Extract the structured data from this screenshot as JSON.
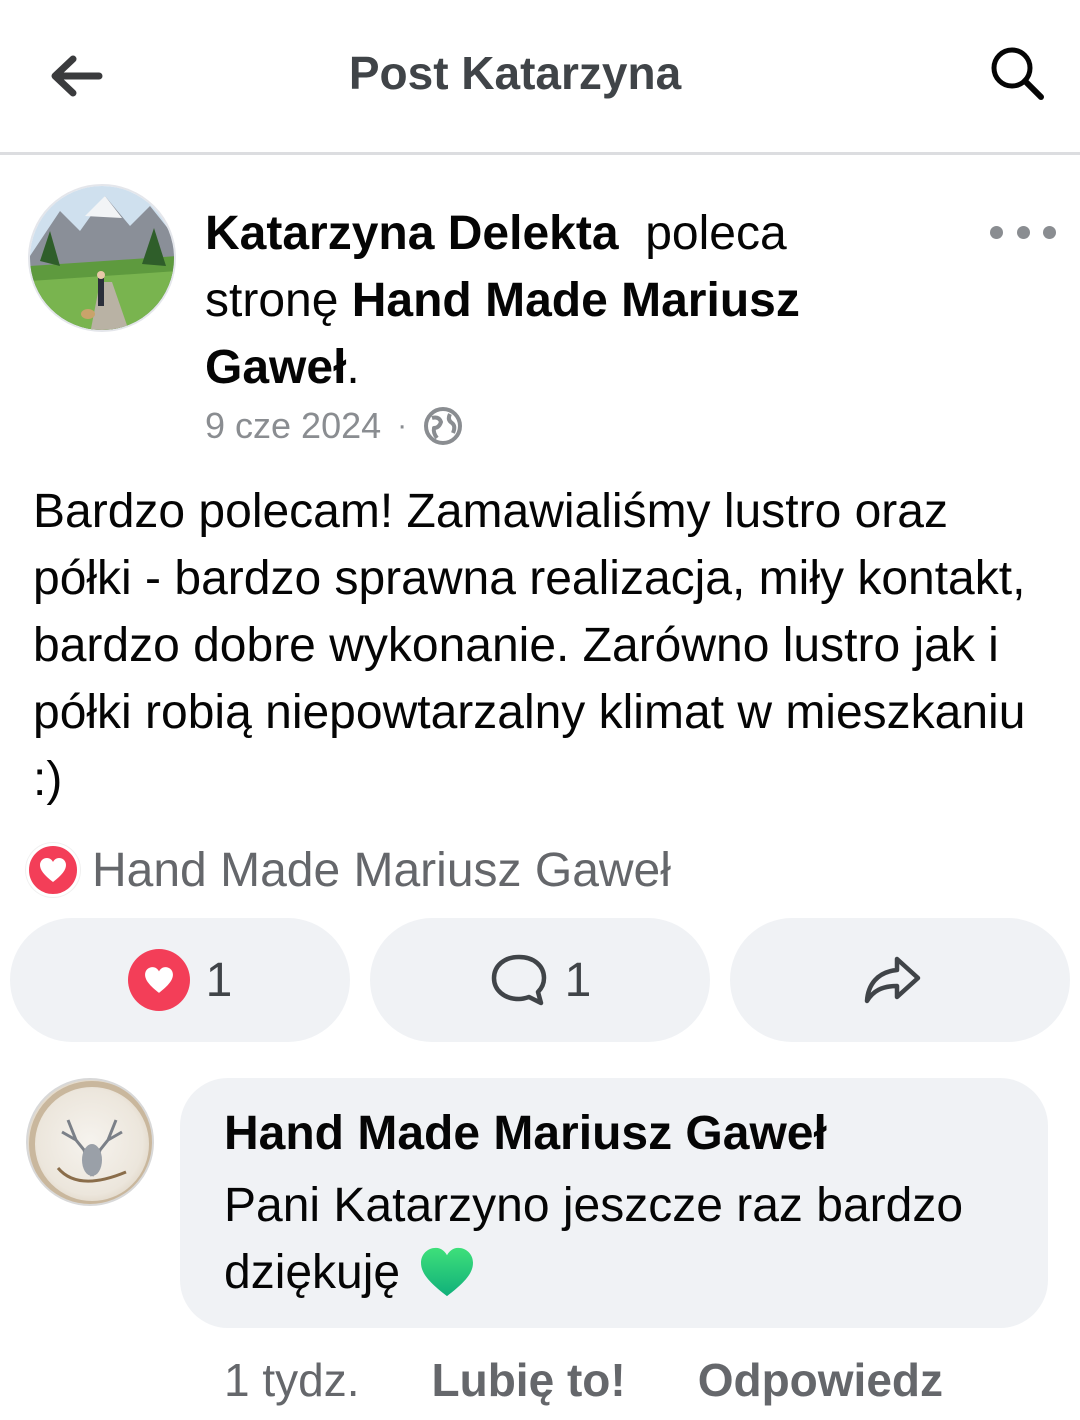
{
  "header": {
    "title": "Post Katarzyna",
    "back_icon": "arrow-left-icon",
    "search_icon": "search-icon"
  },
  "post": {
    "author": "Katarzyna Delekta",
    "action_text_1": "poleca",
    "action_text_2": "stronę",
    "page_name_line1": "Hand Made Mariusz",
    "page_name_line2": "Gaweł",
    "period": ".",
    "date": "9 cze 2024",
    "separator": "·",
    "privacy_icon": "globe-icon",
    "more_icon": "more-dots-icon",
    "body": "Bardzo polecam! Zamawialiśmy lustro oraz półki - bardzo sprawna realizacja, miły kontakt, bardzo dobre wykonanie. Zarówno lustro jak i półki robią niepowtarzalny klimat w mieszkaniu :)",
    "reaction_summary_name": "Hand Made Mariusz Gaweł"
  },
  "actions": {
    "love_count": "1",
    "comment_count": "1",
    "share_label": ""
  },
  "comment": {
    "author": "Hand Made Mariusz Gaweł",
    "text": "Pani Katarzyno jeszcze raz bardzo dziękuję",
    "time": "1 tydz.",
    "like_label": "Lubię to!",
    "reply_label": "Odpowiedz"
  },
  "colors": {
    "love_red": "#f33e58",
    "bubble_bg": "#f0f2f5",
    "muted_text": "#65676b"
  }
}
